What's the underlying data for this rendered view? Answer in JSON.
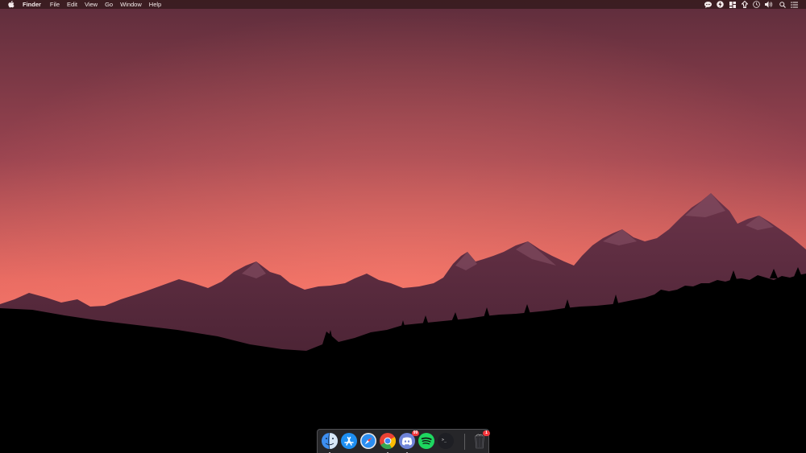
{
  "menubar": {
    "app_name": "Finder",
    "items": [
      {
        "label": "File"
      },
      {
        "label": "Edit"
      },
      {
        "label": "View"
      },
      {
        "label": "Go"
      },
      {
        "label": "Window"
      },
      {
        "label": "Help"
      }
    ],
    "status_icons": [
      "chat-bubble-icon",
      "bolt-icon",
      "grid-icon",
      "upload-arrow-icon",
      "clock-icon",
      "volume-icon",
      "search-icon",
      "control-center-icon"
    ]
  },
  "desktop": {
    "wallpaper": "mountain-sunset",
    "sky_top_color": "#5e2d3c",
    "sky_glow_color": "#f7776a",
    "mountain_color": "#5b2c3f",
    "forest_color": "#000000"
  },
  "dock": {
    "apps": [
      {
        "name": "Finder",
        "icon": "finder-icon",
        "running": true
      },
      {
        "name": "App Store",
        "icon": "app-store-icon",
        "running": false
      },
      {
        "name": "Safari",
        "icon": "safari-icon",
        "running": false
      },
      {
        "name": "Google Chrome",
        "icon": "chrome-icon",
        "running": true
      },
      {
        "name": "Discord",
        "icon": "discord-icon",
        "running": true,
        "badge": "99"
      },
      {
        "name": "Spotify",
        "icon": "spotify-icon",
        "running": false
      },
      {
        "name": "Terminal",
        "icon": "terminal-icon",
        "running": false,
        "glyph": ">_"
      }
    ],
    "trash": {
      "name": "Trash",
      "icon": "trash-icon",
      "badge": "1"
    }
  }
}
